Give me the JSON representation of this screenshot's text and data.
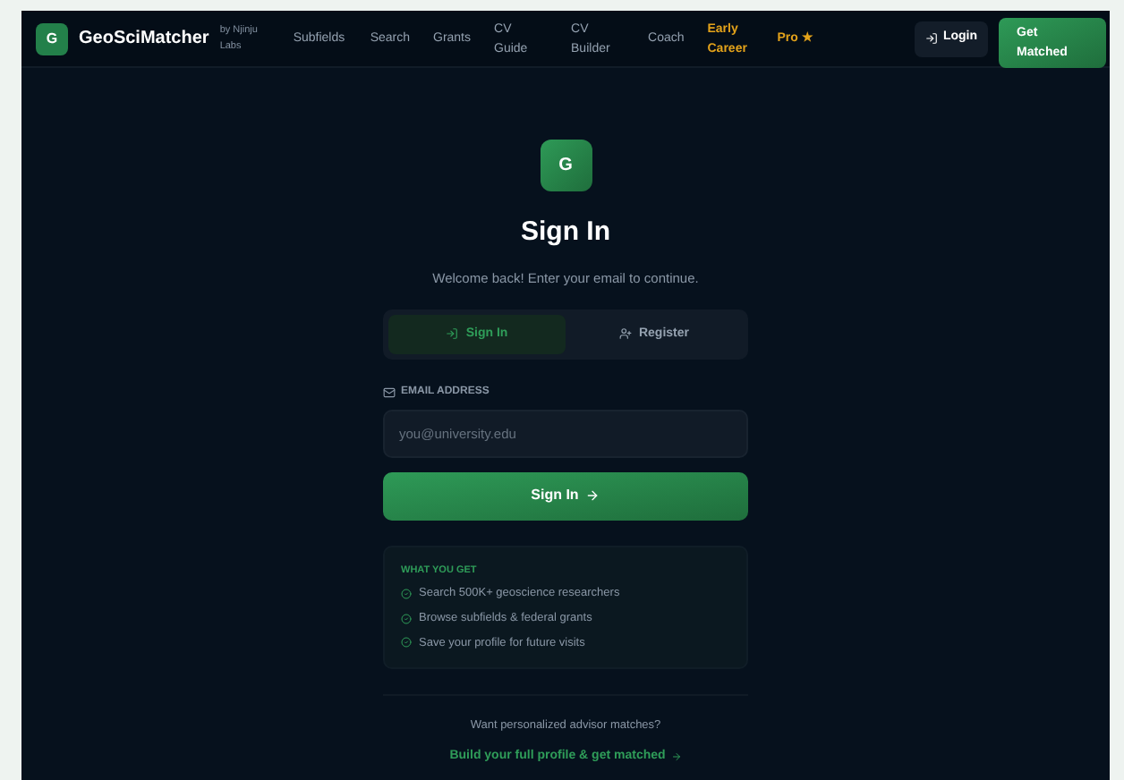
{
  "nav": {
    "logo_letter": "G",
    "brand": "GeoSciMatcher",
    "byline": "by Njinju Labs",
    "links": [
      {
        "label": "Subfields",
        "kind": "plain"
      },
      {
        "label": "Search",
        "kind": "plain"
      },
      {
        "label": "Grants",
        "kind": "plain"
      },
      {
        "label": "CV Guide",
        "kind": "plain"
      },
      {
        "label": "CV Builder",
        "kind": "plain"
      },
      {
        "label": "Coach",
        "kind": "plain"
      },
      {
        "label": "Early Career",
        "kind": "highlight"
      },
      {
        "label": "Pro ★",
        "kind": "highlight"
      }
    ],
    "login": "Login",
    "cta": "Get Matched"
  },
  "card": {
    "logo_letter": "G",
    "title": "Sign In",
    "subtitle": "Welcome back! Enter your email to continue.",
    "tabs": [
      {
        "label": "Sign In",
        "selected": true
      },
      {
        "label": "Register",
        "selected": false
      }
    ],
    "email_label": "EMAIL ADDRESS",
    "email_placeholder": "you@university.edu",
    "submit": "Sign In",
    "benefits_title": "WHAT YOU GET",
    "benefits": [
      "Search 500K+ geoscience researchers",
      "Browse subfields & federal grants",
      "Save your profile for future visits"
    ],
    "prompt": "Want personalized advisor matches?",
    "link": "Build your full profile & get matched"
  }
}
